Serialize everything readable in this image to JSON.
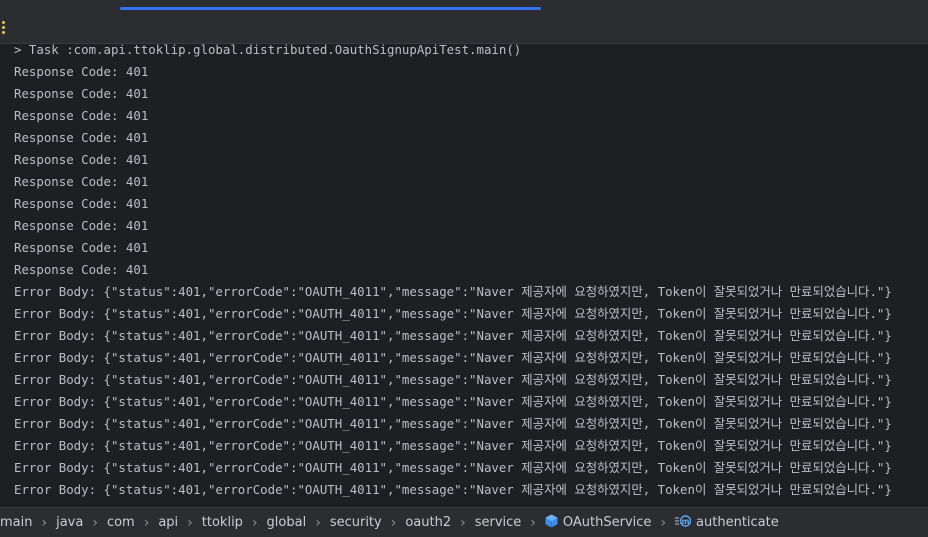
{
  "console": {
    "task_line": "> Task :com.api.ttoklip.global.distributed.OauthSignupApiTest.main()",
    "response_lines": [
      "Response Code: 401",
      "Response Code: 401",
      "Response Code: 401",
      "Response Code: 401",
      "Response Code: 401",
      "Response Code: 401",
      "Response Code: 401",
      "Response Code: 401",
      "Response Code: 401",
      "Response Code: 401"
    ],
    "error_lines": [
      "Error Body: {\"status\":401,\"errorCode\":\"OAUTH_4011\",\"message\":\"Naver 제공자에 요청하였지만, Token이 잘못되었거나 만료되었습니다.\"}",
      "Error Body: {\"status\":401,\"errorCode\":\"OAUTH_4011\",\"message\":\"Naver 제공자에 요청하였지만, Token이 잘못되었거나 만료되었습니다.\"}",
      "Error Body: {\"status\":401,\"errorCode\":\"OAUTH_4011\",\"message\":\"Naver 제공자에 요청하였지만, Token이 잘못되었거나 만료되었습니다.\"}",
      "Error Body: {\"status\":401,\"errorCode\":\"OAUTH_4011\",\"message\":\"Naver 제공자에 요청하였지만, Token이 잘못되었거나 만료되었습니다.\"}",
      "Error Body: {\"status\":401,\"errorCode\":\"OAUTH_4011\",\"message\":\"Naver 제공자에 요청하였지만, Token이 잘못되었거나 만료되었습니다.\"}",
      "Error Body: {\"status\":401,\"errorCode\":\"OAUTH_4011\",\"message\":\"Naver 제공자에 요청하였지만, Token이 잘못되었거나 만료되었습니다.\"}",
      "Error Body: {\"status\":401,\"errorCode\":\"OAUTH_4011\",\"message\":\"Naver 제공자에 요청하였지만, Token이 잘못되었거나 만료되었습니다.\"}",
      "Error Body: {\"status\":401,\"errorCode\":\"OAUTH_4011\",\"message\":\"Naver 제공자에 요청하였지만, Token이 잘못되었거나 만료되었습니다.\"}",
      "Error Body: {\"status\":401,\"errorCode\":\"OAUTH_4011\",\"message\":\"Naver 제공자에 요청하였지만, Token이 잘못되었거나 만료되었습니다.\"}",
      "Error Body: {\"status\":401,\"errorCode\":\"OAUTH_4011\",\"message\":\"Naver 제공자에 요청하였지만, Token이 잘못되었거나 만료되었습니다.\"}"
    ]
  },
  "breadcrumb": {
    "items": [
      "main",
      "java",
      "com",
      "api",
      "ttoklip",
      "global",
      "security",
      "oauth2",
      "service",
      "OAuthService",
      "authenticate"
    ],
    "class_icon": "class-cube-icon",
    "method_icon": "method-icon",
    "separator_icon": "chevron-right-icon"
  },
  "colors": {
    "background": "#1e1f22",
    "panel": "#2b2d30",
    "text": "#bcbec4",
    "accent": "#3574f0",
    "class_icon": "#3d8ee8",
    "kebab_icon": "#f0c24a"
  }
}
